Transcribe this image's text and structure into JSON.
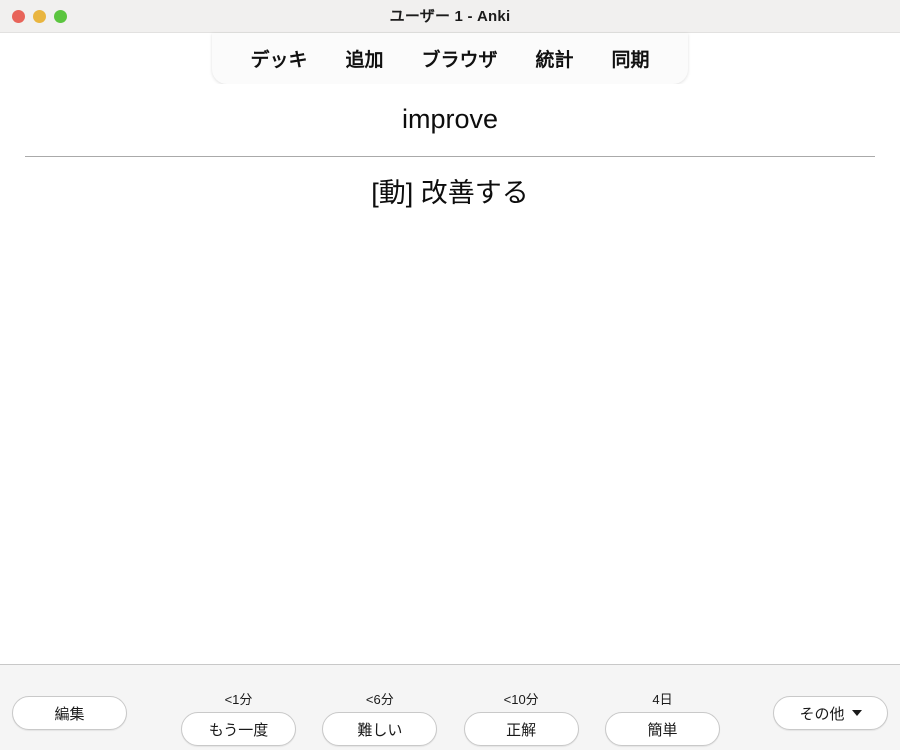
{
  "window": {
    "title": "ユーザー 1 - Anki",
    "traffic_lights": [
      {
        "name": "close",
        "color": "#e8645a"
      },
      {
        "name": "minimize",
        "color": "#e9b53f"
      },
      {
        "name": "zoom",
        "color": "#5bc53f"
      }
    ]
  },
  "toolbar": {
    "items": [
      {
        "label": "デッキ"
      },
      {
        "label": "追加"
      },
      {
        "label": "ブラウザ"
      },
      {
        "label": "統計"
      },
      {
        "label": "同期"
      }
    ]
  },
  "card": {
    "question": "improve",
    "answer": "[動] 改善する"
  },
  "answer_bar": {
    "edit_label": "編集",
    "more_label": "その他",
    "more_caret": "▾",
    "ease_buttons": [
      {
        "interval": "<1分",
        "label": "もう一度"
      },
      {
        "interval": "<6分",
        "label": "難しい"
      },
      {
        "interval": "<10分",
        "label": "正解"
      },
      {
        "interval": "4日",
        "label": "簡単"
      }
    ]
  }
}
